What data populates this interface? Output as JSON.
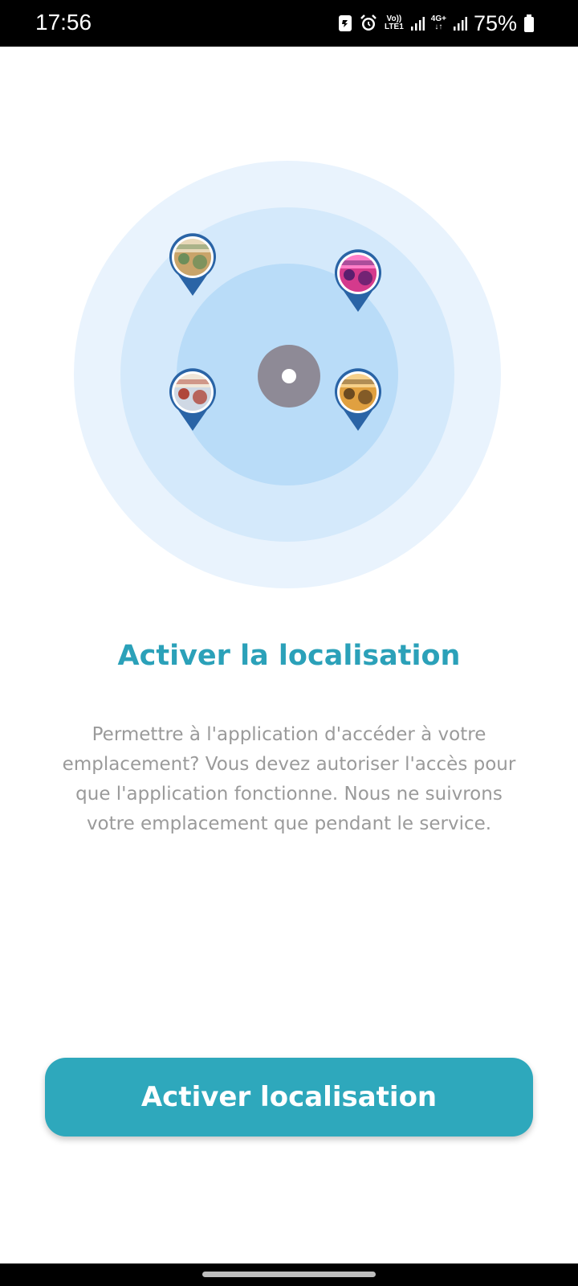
{
  "status_bar": {
    "time": "17:56",
    "volte_label_top": "Vo))",
    "volte_label_bottom": "LTE1",
    "network_type_top": "4G+",
    "network_type_bottom": "↓↑",
    "battery_percent": "75%",
    "icons": [
      "sim-app-icon",
      "alarm-icon",
      "signal-icon",
      "signal-icon",
      "battery-icon"
    ]
  },
  "illustration": {
    "pins": [
      {
        "name": "pin-market-icon",
        "palette": [
          "#c9a46a",
          "#6d8e5a",
          "#e8d8b8"
        ]
      },
      {
        "name": "pin-concert-icon",
        "palette": [
          "#d43a8c",
          "#5a1e6e",
          "#ff7ec8"
        ]
      },
      {
        "name": "pin-city-icon",
        "palette": [
          "#cfd8e4",
          "#b0473a",
          "#f0e6d8"
        ]
      },
      {
        "name": "pin-food-icon",
        "palette": [
          "#e0a040",
          "#6b4a20",
          "#f6d08a"
        ]
      }
    ],
    "pin_color": "#2a64a6"
  },
  "content": {
    "title": "Activer la localisation",
    "description": "Permettre à l'application d'accéder à votre emplacement? Vous devez autoriser l'accès pour que l'application fonctionne. Nous ne suivrons votre emplacement que pendant le service."
  },
  "actions": {
    "enable_location_label": "Activer localisation"
  },
  "colors": {
    "accent": "#2ba1b9",
    "button": "#2ea8bc",
    "description_text": "#9a9a9a",
    "ring_outer": "#e9f3fd",
    "ring_middle": "#d4e9fb",
    "ring_inner": "#b9dcf8",
    "center_dot": "#8e8a96"
  }
}
